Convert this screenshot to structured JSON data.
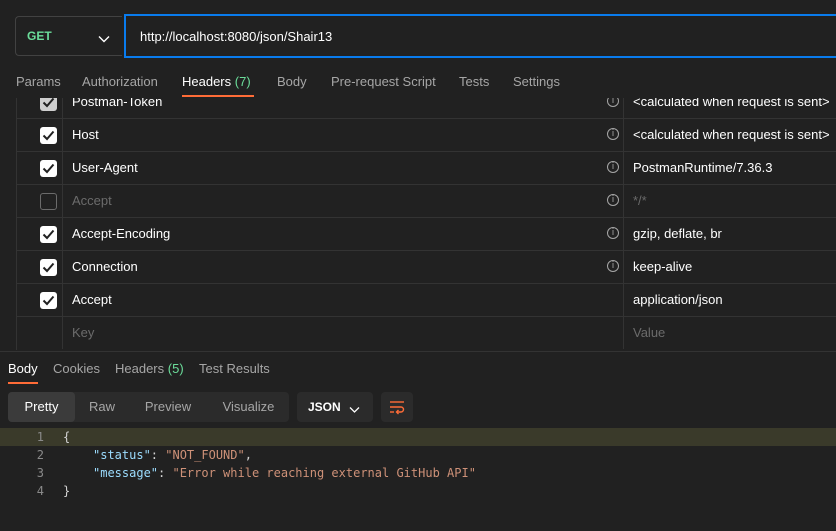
{
  "request": {
    "method": "GET",
    "url": "http://localhost:8080/json/Shair13"
  },
  "request_tabs": [
    {
      "label": "Params"
    },
    {
      "label": "Authorization"
    },
    {
      "label": "Headers",
      "count": "(7)",
      "active": true
    },
    {
      "label": "Body"
    },
    {
      "label": "Pre-request Script"
    },
    {
      "label": "Tests"
    },
    {
      "label": "Settings"
    }
  ],
  "headers": [
    {
      "key": "Postman-Token",
      "value": "<calculated when request is sent>",
      "checked": true,
      "info": true
    },
    {
      "key": "Host",
      "value": "<calculated when request is sent>",
      "checked": true,
      "info": true
    },
    {
      "key": "User-Agent",
      "value": "PostmanRuntime/7.36.3",
      "checked": true,
      "info": true
    },
    {
      "key": "Accept",
      "value": "*/*",
      "checked": false,
      "info": true
    },
    {
      "key": "Accept-Encoding",
      "value": "gzip, deflate, br",
      "checked": true,
      "info": true
    },
    {
      "key": "Connection",
      "value": "keep-alive",
      "checked": true,
      "info": true
    },
    {
      "key": "Accept",
      "value": "application/json",
      "checked": true,
      "info": false
    }
  ],
  "new_header": {
    "key_placeholder": "Key",
    "value_placeholder": "Value"
  },
  "response_tabs": [
    {
      "label": "Body",
      "active": true
    },
    {
      "label": "Cookies"
    },
    {
      "label": "Headers",
      "count": "(5)"
    },
    {
      "label": "Test Results"
    }
  ],
  "view_modes": [
    "Pretty",
    "Raw",
    "Preview",
    "Visualize"
  ],
  "active_view": "Pretty",
  "language": "JSON",
  "code": {
    "line_numbers": [
      "1",
      "2",
      "3",
      "4"
    ],
    "open_brace": "{",
    "close_brace": "}",
    "fields": [
      {
        "key": "\"status\"",
        "value": "\"NOT_FOUND\"",
        "trail": ","
      },
      {
        "key": "\"message\"",
        "value": "\"Error while reaching external GitHub API\"",
        "trail": ""
      }
    ]
  },
  "colors": {
    "accent": "#ff6c37",
    "focus": "#097bed",
    "method_get": "#6bdd9a",
    "background": "#212121"
  }
}
